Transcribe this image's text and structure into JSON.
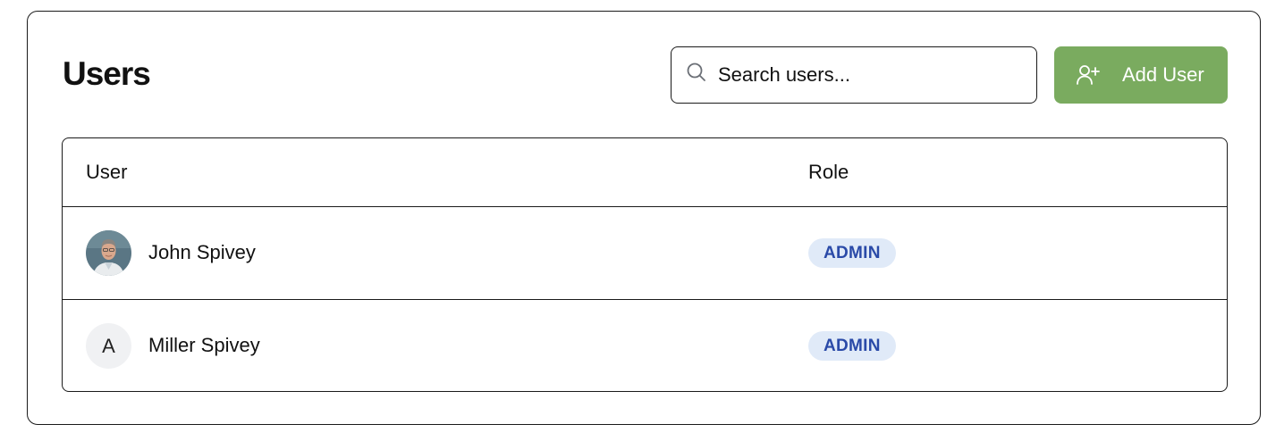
{
  "page": {
    "title": "Users"
  },
  "search": {
    "placeholder": "Search users...",
    "icon": "search-icon"
  },
  "add_button": {
    "label": "Add User",
    "icon": "user-plus-icon",
    "color": "#7aab5f"
  },
  "table": {
    "columns": [
      "User",
      "Role"
    ],
    "rows": [
      {
        "name": "John Spivey",
        "avatar": "photo",
        "role": "ADMIN"
      },
      {
        "name": "Miller Spivey",
        "avatar_initial": "A",
        "role": "ADMIN"
      }
    ]
  },
  "colors": {
    "badge_bg": "#e0eaf8",
    "badge_text": "#2a4aa8",
    "border": "#1a1a1a"
  }
}
